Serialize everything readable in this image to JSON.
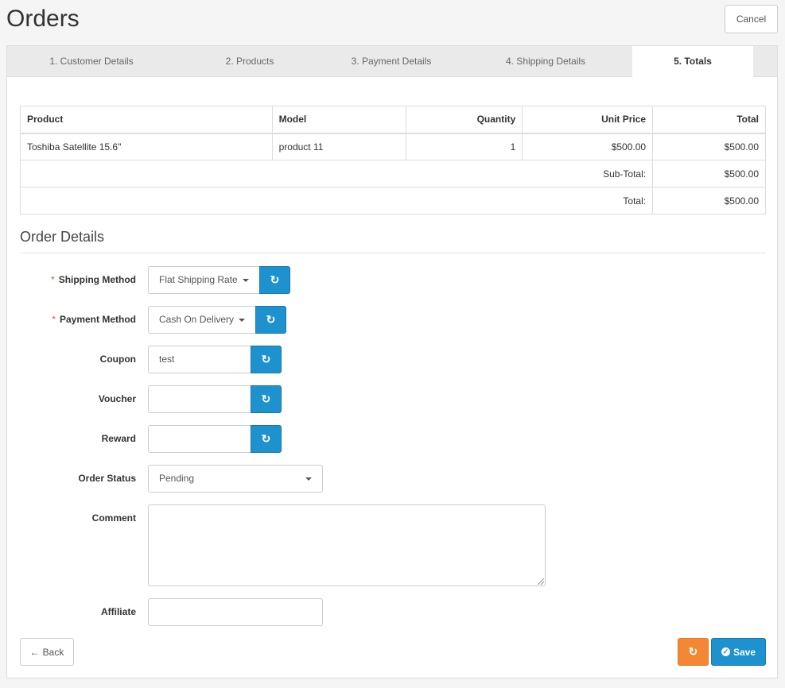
{
  "header": {
    "title": "Orders",
    "cancel_label": "Cancel"
  },
  "tabs": [
    {
      "label": "1. Customer Details",
      "active": false
    },
    {
      "label": "2. Products",
      "active": false
    },
    {
      "label": "3. Payment Details",
      "active": false
    },
    {
      "label": "4. Shipping Details",
      "active": false
    },
    {
      "label": "5. Totals",
      "active": true
    }
  ],
  "products_table": {
    "columns": [
      "Product",
      "Model",
      "Quantity",
      "Unit Price",
      "Total"
    ],
    "rows": [
      {
        "product": "Toshiba Satellite 15.6\"",
        "model": "product 11",
        "quantity": "1",
        "unit_price": "$500.00",
        "total": "$500.00"
      }
    ],
    "totals": [
      {
        "label": "Sub-Total:",
        "value": "$500.00"
      },
      {
        "label": "Total:",
        "value": "$500.00"
      }
    ]
  },
  "order_details": {
    "title": "Order Details",
    "required_marker": "*",
    "shipping_method": {
      "label": "Shipping Method",
      "value": "Flat Shipping Rate"
    },
    "payment_method": {
      "label": "Payment Method",
      "value": "Cash On Delivery"
    },
    "coupon": {
      "label": "Coupon",
      "value": "test"
    },
    "voucher": {
      "label": "Voucher",
      "value": ""
    },
    "reward": {
      "label": "Reward",
      "value": ""
    },
    "order_status": {
      "label": "Order Status",
      "value": "Pending"
    },
    "comment": {
      "label": "Comment",
      "value": ""
    },
    "affiliate": {
      "label": "Affiliate",
      "value": ""
    }
  },
  "footer": {
    "back_label": "Back",
    "save_label": "Save"
  },
  "icons": {
    "refresh": "refresh-icon",
    "back": "arrow-left-icon",
    "save": "check-circle-icon",
    "dropdown": "caret-down-icon"
  },
  "colors": {
    "primary": "#1e91cf",
    "warning": "#f38733",
    "required": "#e3503e"
  }
}
